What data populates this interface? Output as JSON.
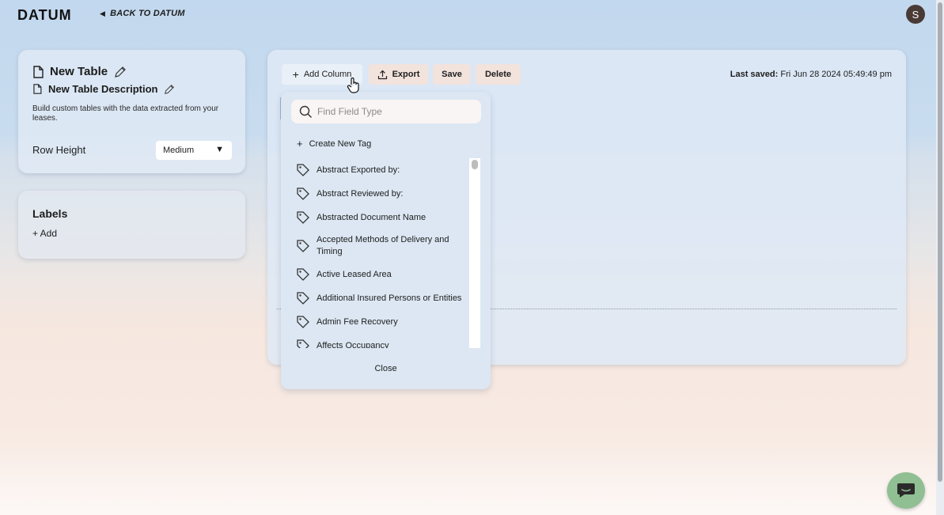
{
  "brand": {
    "logo_text": "DATUM",
    "back_label": "BACK TO DATUM"
  },
  "user": {
    "avatar_initial": "S"
  },
  "table_info": {
    "title": "New Table",
    "description": "New Table Description",
    "help_text": "Build custom tables with the data extracted from your leases.",
    "row_height_label": "Row Height",
    "row_height_value": "Medium"
  },
  "labels": {
    "title": "Labels",
    "add_label": "+ Add"
  },
  "toolbar": {
    "add_column_label": "Add Column",
    "export_label": "Export",
    "save_label": "Save",
    "delete_label": "Delete",
    "last_saved_prefix": "Last saved:",
    "last_saved_value": "Fri Jun 28 2024 05:49:49 pm"
  },
  "field_dropdown": {
    "search_placeholder": "Find Field Type",
    "create_tag_label": "Create New Tag",
    "items": [
      {
        "label": "Abstract Exported by:"
      },
      {
        "label": "Abstract Reviewed by:"
      },
      {
        "label": "Abstracted Document Name"
      },
      {
        "label": "Accepted Methods of Delivery and Timing"
      },
      {
        "label": "Active Leased Area"
      },
      {
        "label": "Additional Insured Persons or Entities"
      },
      {
        "label": "Admin Fee Recovery"
      },
      {
        "label": "Affects Occupancy"
      }
    ],
    "close_label": "Close"
  },
  "colors": {
    "accent_button": "#f2e3dd",
    "avatar": "#4a3a36",
    "chat_button": "#8fbf92"
  },
  "icons": {
    "chat": "chat-bubble-icon",
    "tag": "tag-icon",
    "search": "search-icon"
  }
}
